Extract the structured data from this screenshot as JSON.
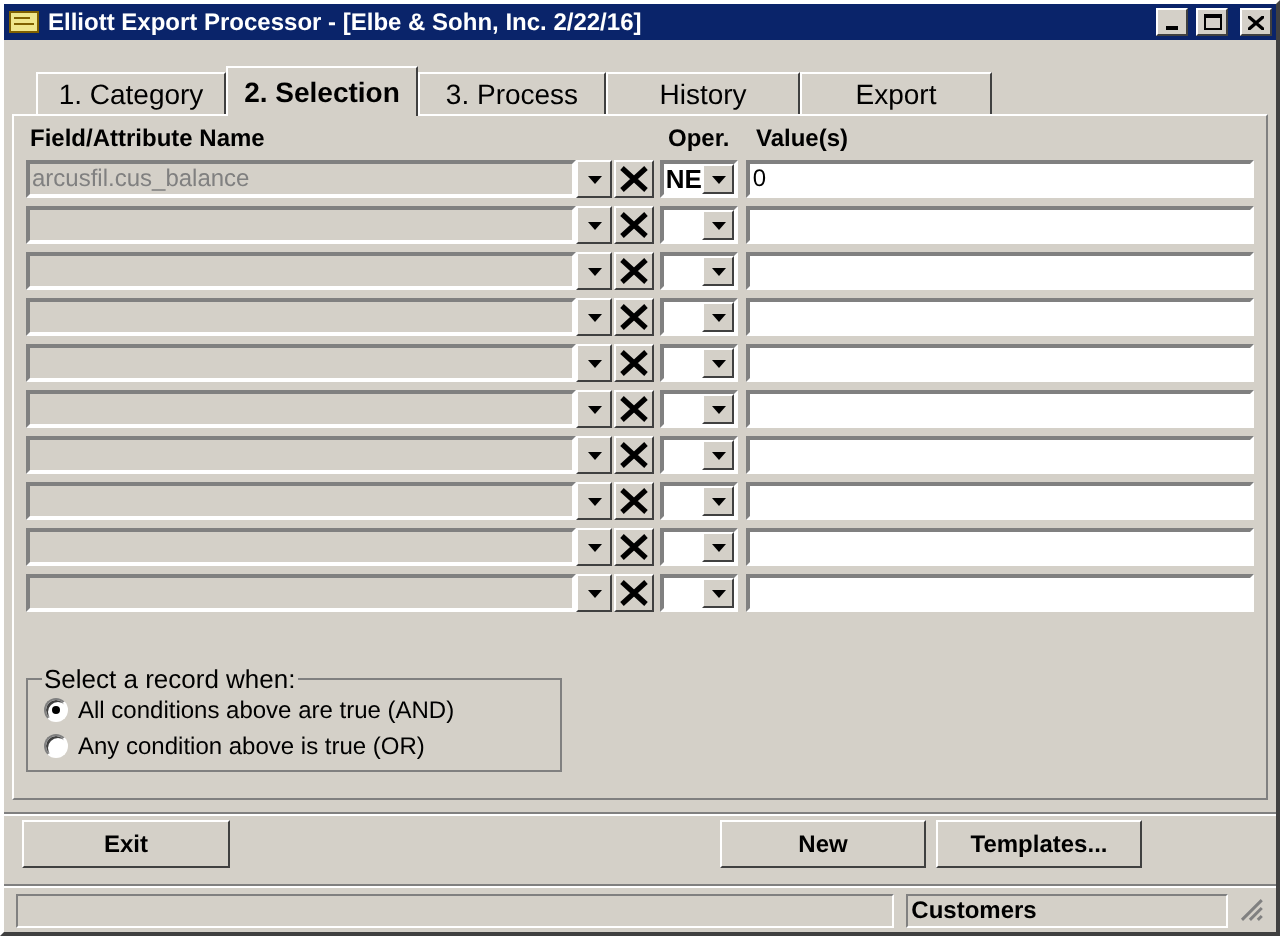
{
  "window": {
    "title": "Elliott Export Processor - [Elbe & Sohn, Inc. 2/22/16]"
  },
  "tabs": [
    {
      "label": "1. Category",
      "selected": false
    },
    {
      "label": "2. Selection",
      "selected": true
    },
    {
      "label": "3. Process",
      "selected": false
    },
    {
      "label": "History",
      "selected": false
    },
    {
      "label": "Export",
      "selected": false
    }
  ],
  "columns": {
    "field": "Field/Attribute Name",
    "operator": "Oper.",
    "values": "Value(s)"
  },
  "rows": [
    {
      "field": "arcusfil.cus_balance",
      "field_disabled": true,
      "operator": "NE",
      "value": "0"
    },
    {
      "field_disabled": true
    },
    {
      "field_disabled": true
    },
    {
      "field_disabled": true
    },
    {
      "field_disabled": true
    },
    {
      "field_disabled": true
    },
    {
      "field_disabled": true
    },
    {
      "field_disabled": true
    },
    {
      "field_disabled": true
    },
    {
      "field_disabled": true
    }
  ],
  "match_group": {
    "title": "Select a record when:",
    "options": [
      {
        "label": "All conditions above are true (AND)",
        "selected": true
      },
      {
        "label": "Any condition above is true (OR)",
        "selected": false
      }
    ]
  },
  "buttons": [
    {
      "label": "Exit"
    },
    {
      "label": "New"
    },
    {
      "label": "Templates..."
    }
  ],
  "status_bar": {
    "panel_1": "Customers"
  }
}
